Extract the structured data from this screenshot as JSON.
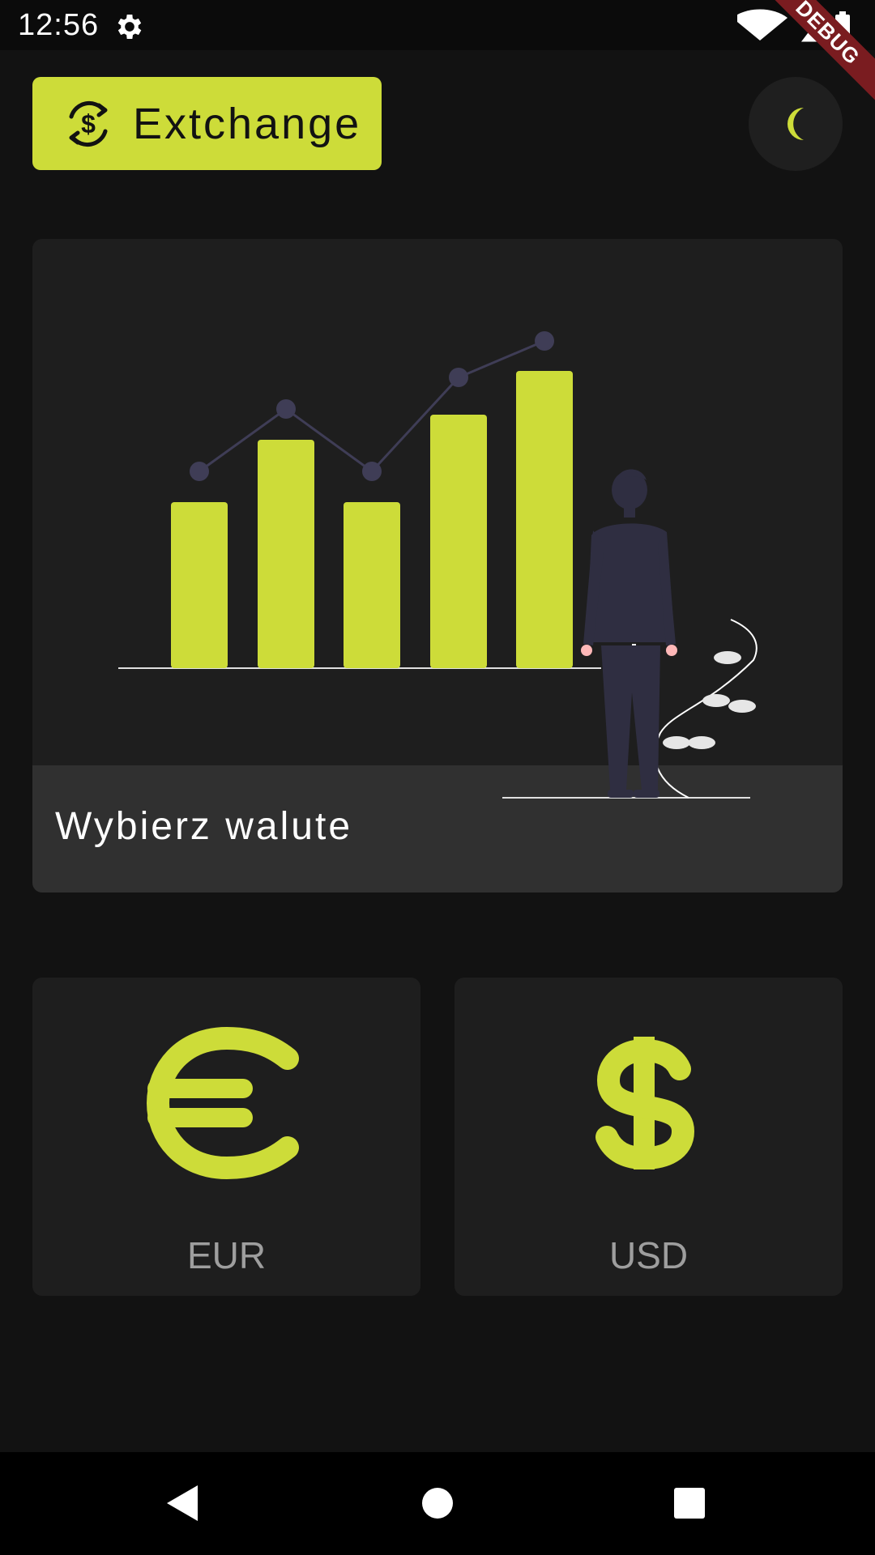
{
  "status_bar": {
    "time": "12:56",
    "icons": [
      "settings-icon",
      "wifi-icon",
      "cell-signal-icon",
      "battery-icon"
    ]
  },
  "debug_banner": "DEBUG",
  "header": {
    "brand_label": "Extchange",
    "brand_icon": "currency-exchange-icon",
    "theme_toggle_icon": "moon-icon"
  },
  "hero": {
    "title": "Wybierz walute",
    "illustration": "growth-chart-illustration"
  },
  "currencies": [
    {
      "code": "EUR",
      "icon": "euro-icon"
    },
    {
      "code": "USD",
      "icon": "dollar-icon"
    }
  ],
  "nav_bar": {
    "buttons": [
      "back-icon",
      "home-icon",
      "recents-icon"
    ]
  },
  "colors": {
    "accent": "#cddc39",
    "background": "#121212",
    "card": "#1e1e1e",
    "card_footer": "#303030",
    "muted_text": "#9e9e9e",
    "figure": "#2f2e41"
  }
}
